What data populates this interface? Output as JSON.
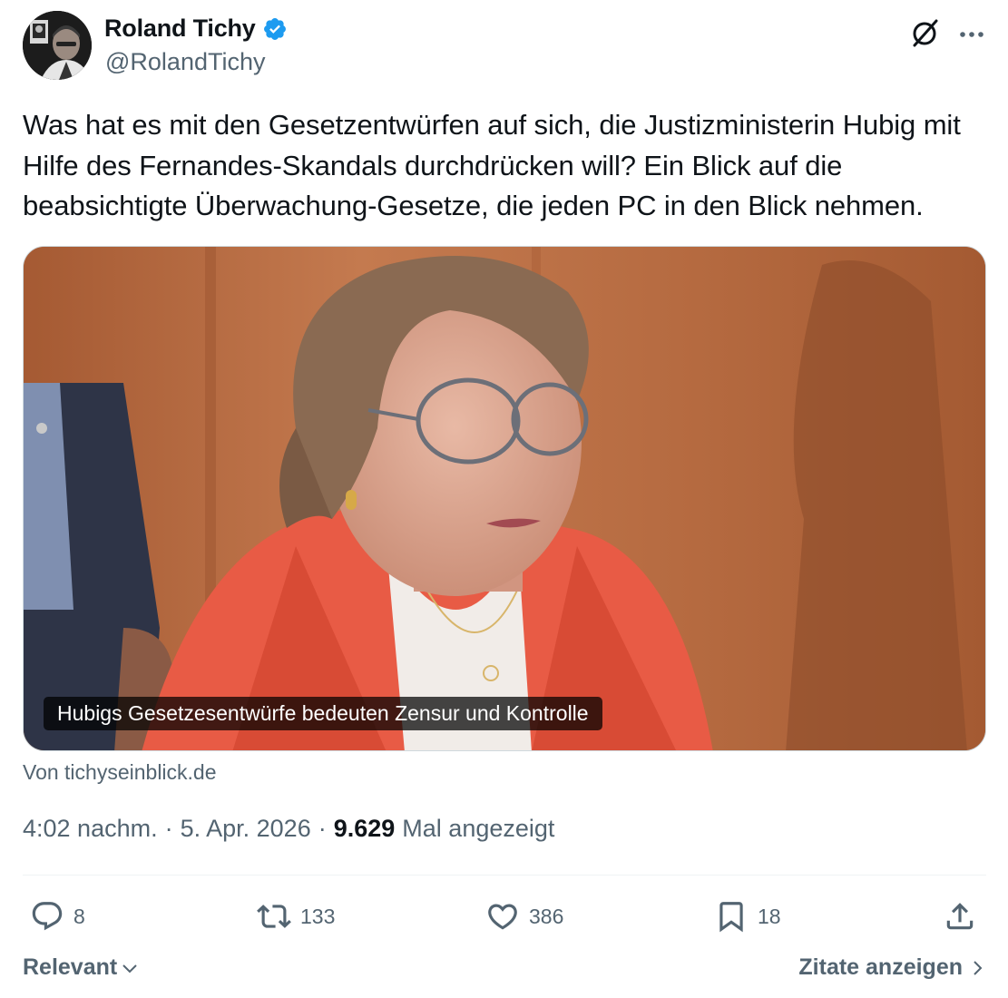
{
  "author": {
    "name": "Roland Tichy",
    "handle": "@RolandTichy",
    "verified": true
  },
  "header_icons": [
    "grok-icon",
    "more-icon"
  ],
  "tweet": {
    "text": "Was hat es mit den Gesetzentwürfen auf sich, die Justizministerin Hubig mit Hilfe des Fernandes-Skandals durchdrücken will? Ein Blick auf die beabsichtigte Überwachung-Gesetze, die jeden PC in den Blick nehmen."
  },
  "link_card": {
    "caption": "Hubigs Gesetzesentwürfe bedeuten Zensur und Kontrolle",
    "source": "Von tichyseinblick.de"
  },
  "meta": {
    "time": "4:02 nachm.",
    "date": "5. Apr. 2026",
    "views_count": "9.629",
    "views_label": "Mal angezeigt"
  },
  "actions": {
    "replies": "8",
    "reposts": "133",
    "likes": "386",
    "bookmarks": "18"
  },
  "footer": {
    "sort_label": "Relevant",
    "quotes_label": "Zitate anzeigen"
  },
  "colors": {
    "text": "#0f1419",
    "secondary": "#536471",
    "verified": "#1d9bf0",
    "divider": "#eff3f4"
  }
}
